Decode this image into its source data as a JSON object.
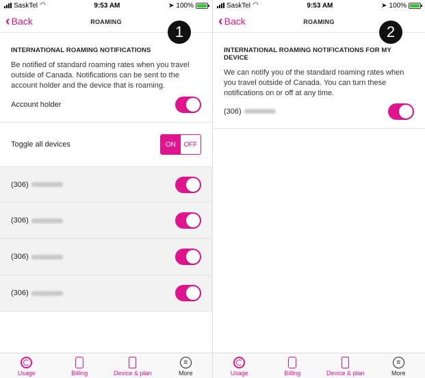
{
  "status": {
    "carrier": "SaskTel",
    "time": "9:53 AM",
    "battery": "100%"
  },
  "nav": {
    "back_label": "Back",
    "title": "ROAMING"
  },
  "left": {
    "badge": "1",
    "heading": "INTERNATIONAL ROAMING NOTIFICATIONS",
    "description": "Be notified of standard roaming rates when you travel outside of Canada. Notifications can be sent to the account holder and the device that is roaming.",
    "account_label": "Account holder",
    "toggle_all_label": "Toggle all devices",
    "on_label": "ON",
    "off_label": "OFF",
    "devices": [
      {
        "prefix": "(306)"
      },
      {
        "prefix": "(306)"
      },
      {
        "prefix": "(306)"
      },
      {
        "prefix": "(306)"
      }
    ]
  },
  "right": {
    "badge": "2",
    "heading": "INTERNATIONAL ROAMING NOTIFICATIONS FOR MY DEVICE",
    "description": "We can notify you of the standard roaming rates when you travel outside of Canada. You can turn these notifications on or off at any time.",
    "device_prefix": "(306)"
  },
  "tabs": [
    {
      "label": "Usage",
      "icon": "usage-icon"
    },
    {
      "label": "Billing",
      "icon": "billing-icon"
    },
    {
      "label": "Device & plan",
      "icon": "device-icon"
    },
    {
      "label": "More",
      "icon": "more-icon"
    }
  ],
  "colors": {
    "accent": "#e0148c",
    "back": "#d4168e",
    "battery": "#37c43a"
  }
}
